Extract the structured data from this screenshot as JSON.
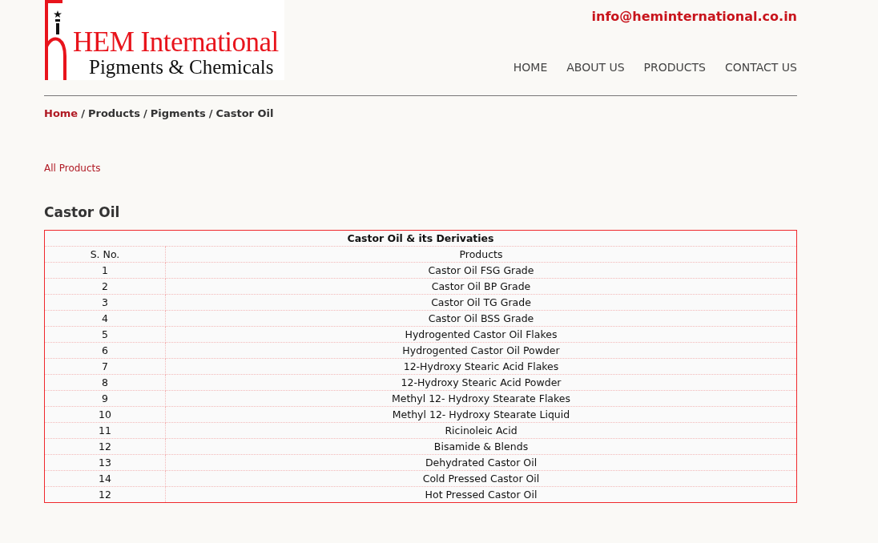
{
  "logo": {
    "name": "HEM International",
    "tagline": "Pigments & Chemicals"
  },
  "email": "info@heminternational.co.in",
  "nav": [
    "HOME",
    "ABOUT US",
    "PRODUCTS",
    "CONTACT US"
  ],
  "breadcrumb": [
    {
      "label": "Home",
      "kind": "link"
    },
    {
      "label": "/",
      "kind": "separator"
    },
    {
      "label": "Products",
      "kind": "text"
    },
    {
      "label": "/",
      "kind": "separator"
    },
    {
      "label": "Pigments",
      "kind": "text"
    },
    {
      "label": "/",
      "kind": "separator"
    },
    {
      "label": "Castor Oil",
      "kind": "text"
    }
  ],
  "all_products_link": "All Products",
  "heading": "Castor Oil",
  "table": {
    "title": "Castor Oil & its Derivaties",
    "columns": [
      "S. No.",
      "Products"
    ],
    "rows": [
      [
        "1",
        "Castor Oil FSG Grade"
      ],
      [
        "2",
        "Castor Oil BP Grade"
      ],
      [
        "3",
        "Castor Oil TG Grade"
      ],
      [
        "4",
        "Castor Oil BSS Grade"
      ],
      [
        "5",
        "Hydrogented Castor Oil Flakes"
      ],
      [
        "6",
        "Hydrogented Castor Oil Powder"
      ],
      [
        "7",
        "12-Hydroxy Stearic Acid Flakes"
      ],
      [
        "8",
        "12-Hydroxy Stearic Acid Powder"
      ],
      [
        "9",
        "Methyl 12- Hydroxy Stearate Flakes"
      ],
      [
        "10",
        "Methyl 12- Hydroxy Stearate Liquid"
      ],
      [
        "11",
        "Ricinoleic Acid"
      ],
      [
        "12",
        "Bisamide & Blends"
      ],
      [
        "13",
        "Dehydrated Castor Oil"
      ],
      [
        "14",
        "Cold Pressed Castor Oil"
      ],
      [
        "12",
        "Hot Pressed Castor Oil"
      ]
    ]
  }
}
